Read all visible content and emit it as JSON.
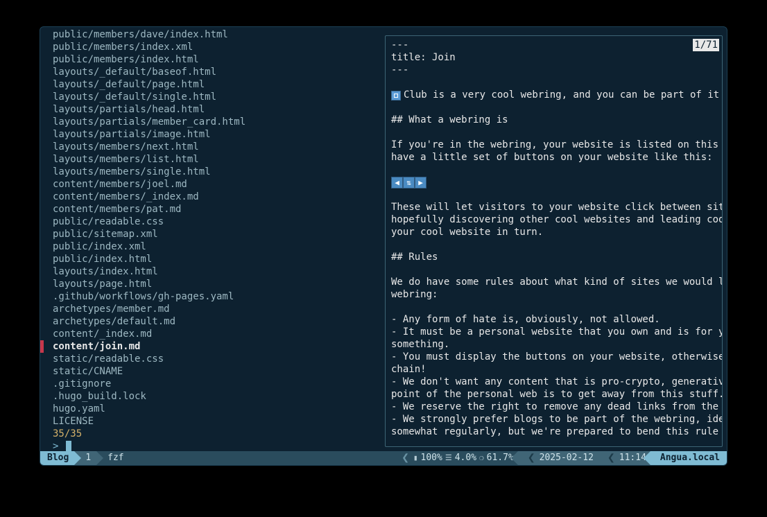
{
  "files": [
    "public/members/dave/index.html",
    "public/members/index.xml",
    "public/members/index.html",
    "layouts/_default/baseof.html",
    "layouts/_default/page.html",
    "layouts/_default/single.html",
    "layouts/partials/head.html",
    "layouts/partials/member_card.html",
    "layouts/partials/image.html",
    "layouts/members/next.html",
    "layouts/members/list.html",
    "layouts/members/single.html",
    "content/members/joel.md",
    "content/members/_index.md",
    "content/members/pat.md",
    "public/readable.css",
    "public/sitemap.xml",
    "public/index.xml",
    "public/index.html",
    "layouts/index.html",
    "layouts/page.html",
    ".github/workflows/gh-pages.yaml",
    "archetypes/member.md",
    "archetypes/default.md",
    "content/_index.md",
    "content/join.md",
    "static/readable.css",
    "static/CNAME",
    ".gitignore",
    ".hugo_build.lock",
    "hugo.yaml",
    "LICENSE"
  ],
  "selected_index": 25,
  "counter": "35/35",
  "prompt": ">",
  "preview_badge": "1/71",
  "preview_lines": [
    "---",
    "title: Join",
    "---",
    "",
    "__DISK__ Club is a very cool webring, and you can be part of it",
    "",
    "## What a webring is",
    "",
    "If you're in the webring, your website is listed on this",
    "have a little set of buttons on your website like this:",
    "",
    "__ARROWS__",
    "",
    "These will let visitors to your website click between sit",
    "hopefully discovering other cool websites and leading coo",
    "your cool website in turn.",
    "",
    "## Rules",
    "",
    "We do have some rules about what kind of sites we would l",
    "webring:",
    "",
    "- Any form of hate is, obviously, not allowed.",
    "- It must be a personal website that you own and is for y",
    "something.",
    "- You must display the buttons on your website, otherwise",
    "chain!",
    "- We don't want any content that is pro-crypto, generativ",
    "point of the personal web is to get away from this stuff.",
    "- We reserve the right to remove any dead links from the",
    "- We strongly prefer blogs to be part of the webring, ide",
    "somewhat regularly, but we're prepared to bend this rule"
  ],
  "status": {
    "session": "Blog",
    "window_num": "1",
    "process": "fzf",
    "battery": "100%",
    "load": "4.0%",
    "mem": "61.7%",
    "date": "2025-02-12",
    "time": "11:14",
    "host": "Angua.local"
  }
}
